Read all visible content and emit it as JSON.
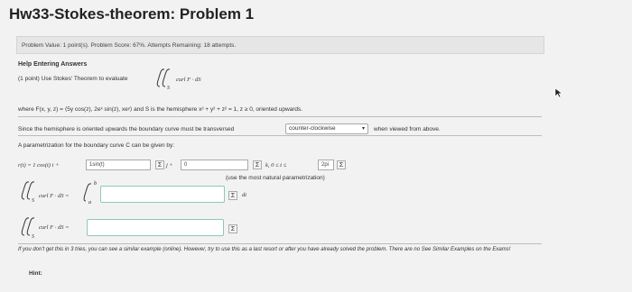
{
  "title": "Hw33-Stokes-theorem: Problem 1",
  "info": {
    "problem_value": "Problem Value: 1 point(s). Problem Score: 67%. Attempts Remaining: 18 attempts."
  },
  "help": "Help Entering Answers",
  "problem": {
    "intro": "(1 point) Use Stokes' Theorem to evaluate",
    "integrand": "curl F · dS",
    "where": "where F(x, y, z) = ⟨5y cos(z), 2eˣ sin(z), xeʸ⟩ and S is the hemisphere x² + y² + z² = 1, z ≥ 0, oriented upwards.",
    "orientation_prefix": "Since the hemisphere is oriented upwards the boundary curve must be transversed",
    "orientation_value": "counter-clockwise",
    "orientation_suffix": "when viewed from above.",
    "param_prompt": "A parametrization for the boundary curve C can be given by:",
    "r_label": "r(t) = 1 cos(t) i +",
    "r_input_i": "1sin(t)",
    "j_label": "j +",
    "r_input_j": "0",
    "k_label": "k,   0 ≤ t ≤",
    "t_upper": "2pi",
    "natural_note": "(use the most natural parametrization)",
    "integral1_label": "curl F · dS =",
    "int_upper": "b",
    "int_lower": "a",
    "dt": "dt",
    "integral2_label": "curl F · dS =",
    "sigma": "Σ",
    "footnote": "If you don't get this in 3 tries, you can see a similar example (online). However, try to use this as a last resort or after you have already solved the problem. There are no See Similar Examples on the Exams!",
    "hint": "Hint:"
  }
}
